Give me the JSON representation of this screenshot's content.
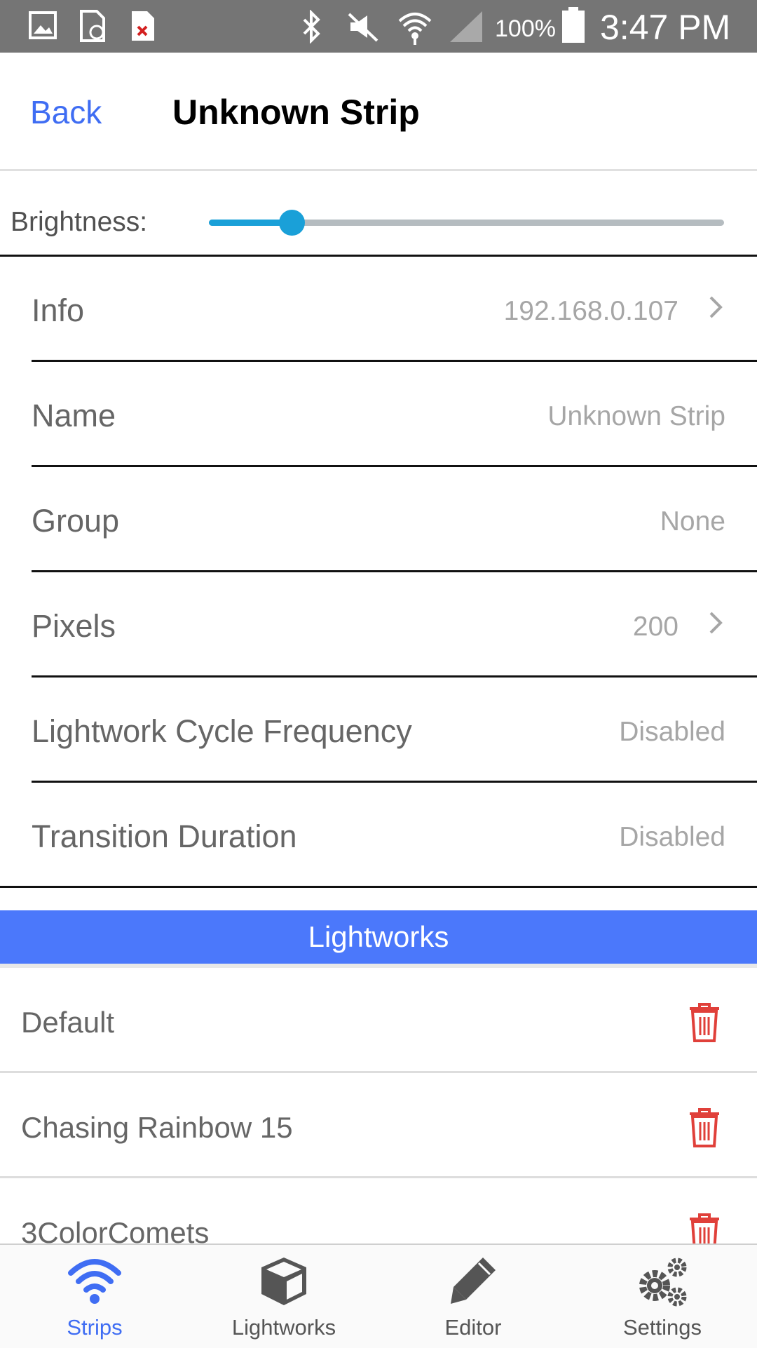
{
  "status_bar": {
    "battery": "100%",
    "time": "3:47 PM",
    "icons": [
      "image-icon",
      "sync-file-icon",
      "error-file-icon",
      "bluetooth-icon",
      "mute-icon",
      "wifi-icon",
      "cell-signal-icon",
      "battery-icon"
    ]
  },
  "header": {
    "back_label": "Back",
    "title": "Unknown Strip"
  },
  "brightness": {
    "label": "Brightness:",
    "level_fraction": 0.16
  },
  "settings": [
    {
      "label": "Info",
      "value": "192.168.0.107",
      "chevron": true
    },
    {
      "label": "Name",
      "value": "Unknown Strip",
      "chevron": false
    },
    {
      "label": "Group",
      "value": "None",
      "chevron": false
    },
    {
      "label": "Pixels",
      "value": "200",
      "chevron": true
    },
    {
      "label": "Lightwork Cycle Frequency",
      "value": "Disabled",
      "chevron": false
    },
    {
      "label": "Transition Duration",
      "value": "Disabled",
      "chevron": false
    }
  ],
  "lightworks_section": {
    "title": "Lightworks",
    "items": [
      "Default",
      "Chasing Rainbow 15",
      "3ColorComets"
    ]
  },
  "tabs": [
    {
      "label": "Strips",
      "icon": "wifi-icon",
      "active": true
    },
    {
      "label": "Lightworks",
      "icon": "cube-icon",
      "active": false
    },
    {
      "label": "Editor",
      "icon": "pencil-icon",
      "active": false
    },
    {
      "label": "Settings",
      "icon": "gears-icon",
      "active": false
    }
  ],
  "colors": {
    "accent": "#3f6df3",
    "section_header": "#4b78fb",
    "slider": "#1aa0d8",
    "delete": "#e0403a",
    "status_bar": "#757575"
  }
}
